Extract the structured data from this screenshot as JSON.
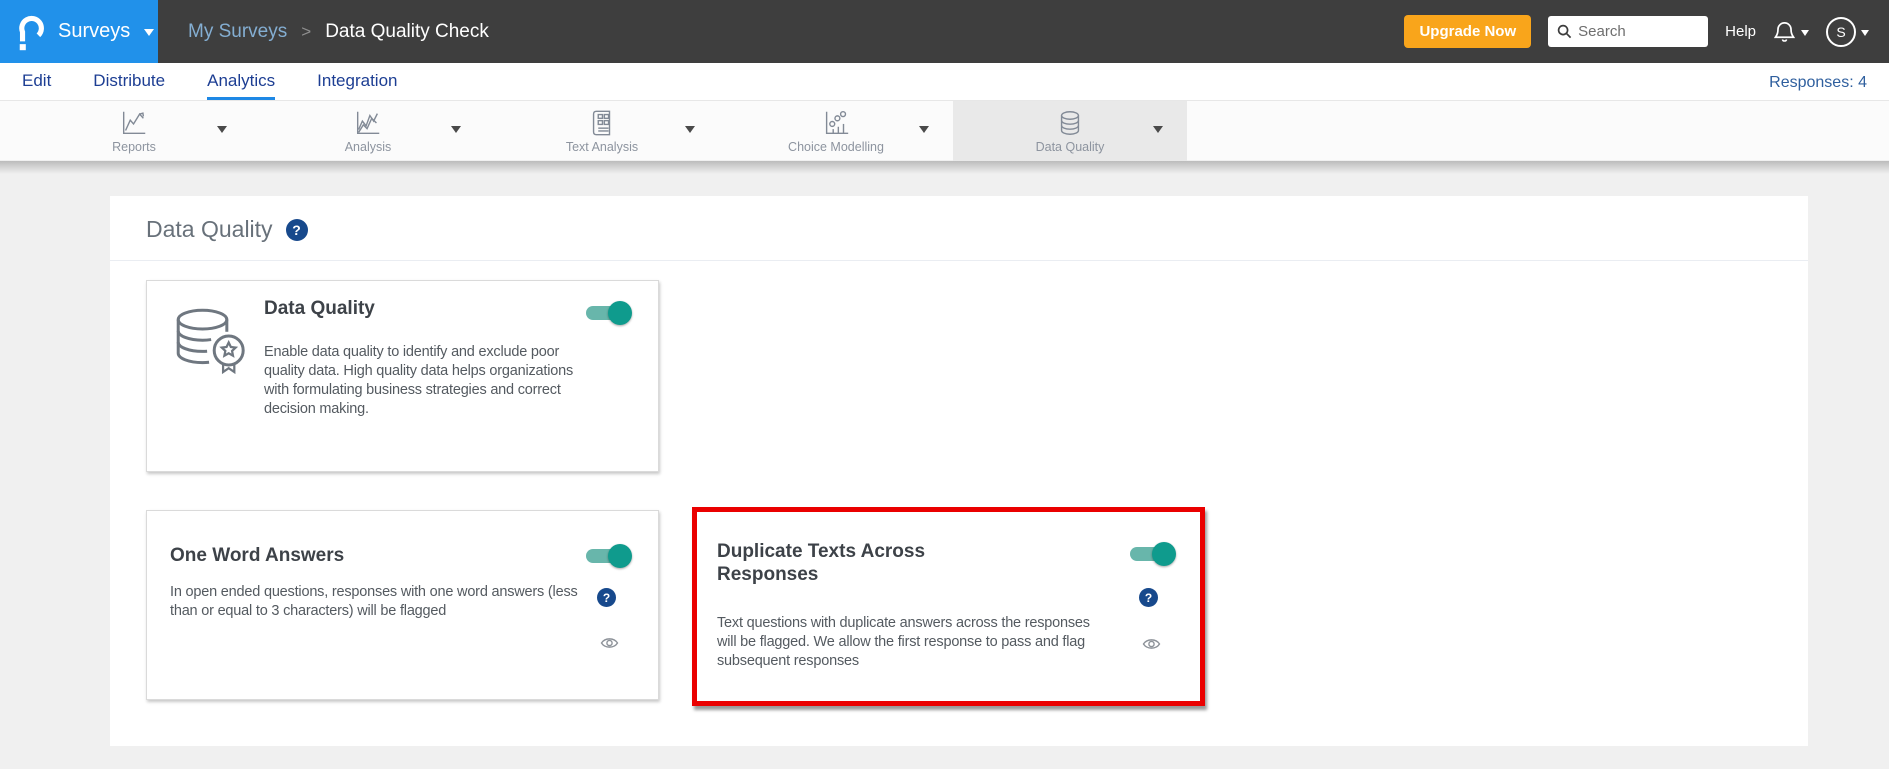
{
  "header": {
    "product": "Surveys",
    "breadcrumb": {
      "parent": "My Surveys",
      "separator": ">",
      "current": "Data Quality Check"
    },
    "upgrade_label": "Upgrade Now",
    "search_placeholder": "Search",
    "help_label": "Help",
    "avatar_initial": "S"
  },
  "nav": {
    "items": [
      {
        "label": "Edit",
        "active": false
      },
      {
        "label": "Distribute",
        "active": false
      },
      {
        "label": "Analytics",
        "active": true
      },
      {
        "label": "Integration",
        "active": false
      }
    ],
    "responses_label": "Responses: 4"
  },
  "tabs": {
    "items": [
      {
        "label": "Reports",
        "icon": "reports-chart-icon",
        "active": false
      },
      {
        "label": "Analysis",
        "icon": "analysis-chart-icon",
        "active": false
      },
      {
        "label": "Text Analysis",
        "icon": "text-analysis-icon",
        "active": false
      },
      {
        "label": "Choice Modelling",
        "icon": "choice-modelling-icon",
        "active": false
      },
      {
        "label": "Data Quality",
        "icon": "data-quality-icon",
        "active": true
      }
    ]
  },
  "main": {
    "heading": "Data Quality",
    "help_glyph": "?",
    "cards": [
      {
        "title": "Data Quality",
        "description": "Enable data quality to identify and exclude poor quality data. High quality data helps organizations with formulating business strategies and correct decision making.",
        "toggle_on": true
      },
      {
        "title": "One Word Answers",
        "description": "In open ended questions, responses with one word answers (less than or equal to 3 characters) will be flagged",
        "toggle_on": true
      },
      {
        "title": "Duplicate Texts Across Responses",
        "description": "Text questions with duplicate answers across the responses will be flagged. We allow the first response to pass and flag subsequent responses",
        "toggle_on": true,
        "highlighted": true
      }
    ]
  },
  "colors": {
    "brand_blue": "#2191ea",
    "topbar_dark": "#3e3e3e",
    "upgrade_orange": "#f9a51b",
    "nav_navy": "#1d3e93",
    "active_underline": "#1e88e5",
    "toggle_on_teal": "#0f9b8d",
    "help_navy": "#17498c",
    "highlight_red": "#ea0000"
  }
}
